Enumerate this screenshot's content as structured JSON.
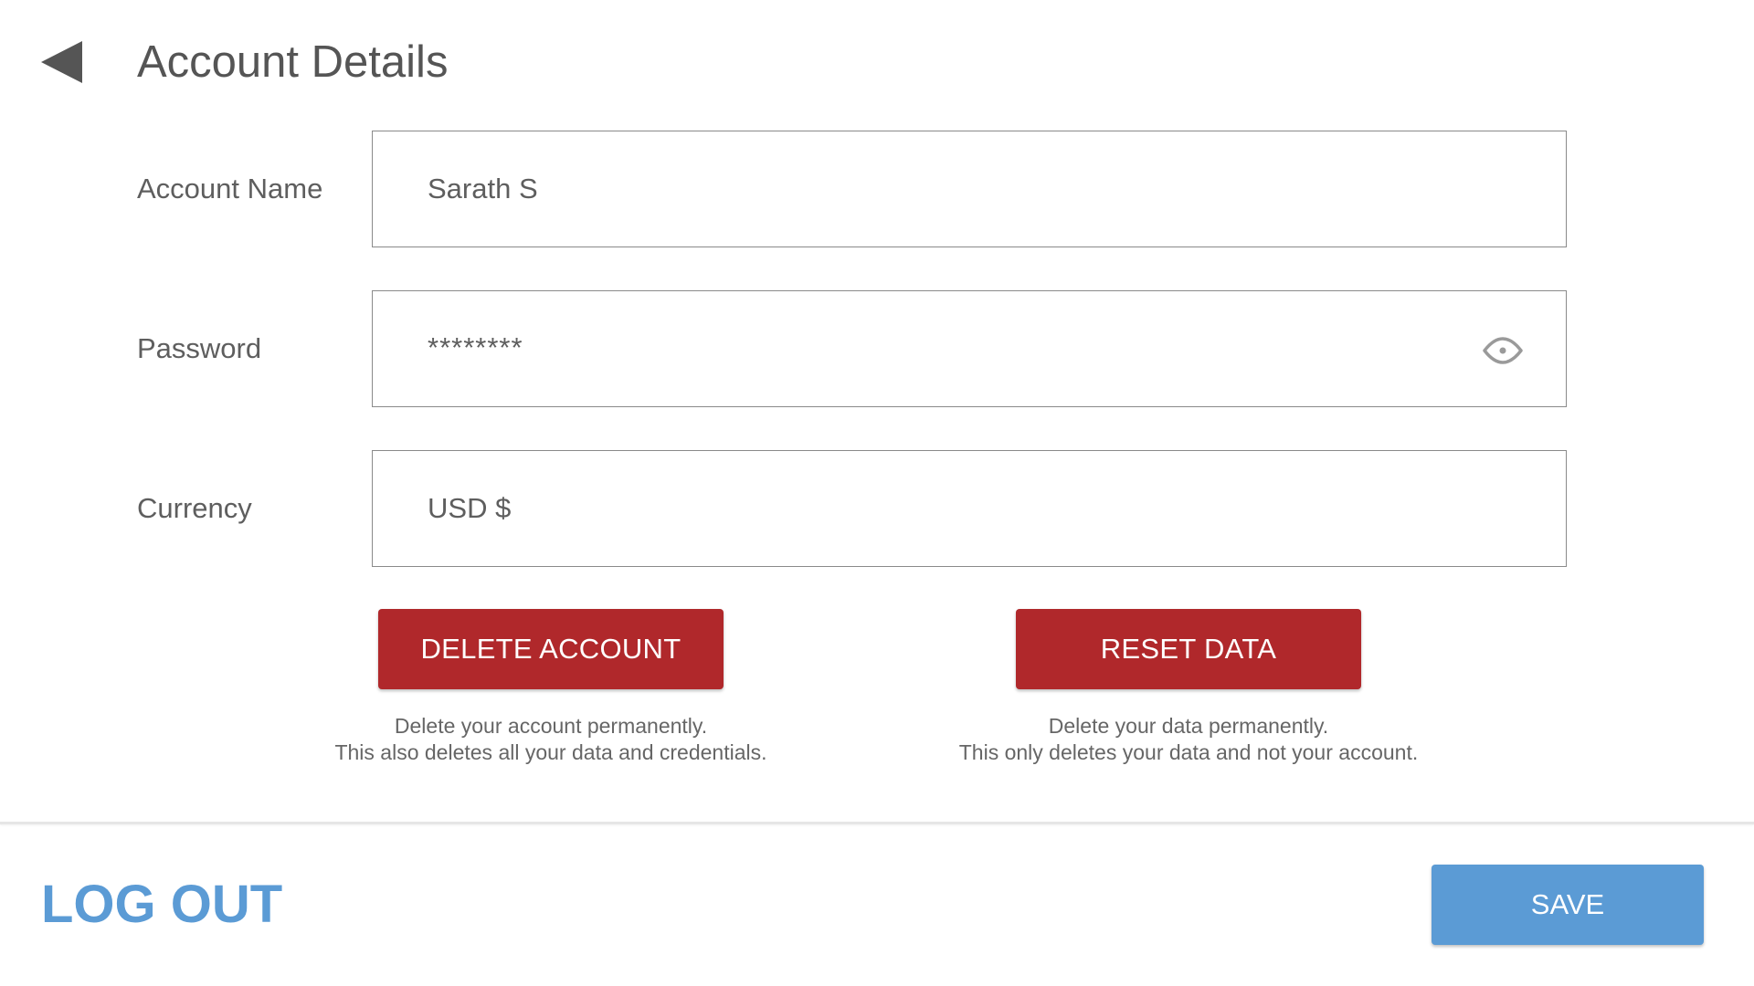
{
  "header": {
    "title": "Account Details"
  },
  "form": {
    "account_name": {
      "label": "Account Name",
      "value": "Sarath S"
    },
    "password": {
      "label": "Password",
      "value": "********"
    },
    "currency": {
      "label": "Currency",
      "value": "USD $"
    }
  },
  "actions": {
    "delete_account": {
      "label": "DELETE ACCOUNT",
      "help_line1": "Delete your account permanently.",
      "help_line2": "This also deletes all your data and credentials."
    },
    "reset_data": {
      "label": "RESET DATA",
      "help_line1": "Delete your data permanently.",
      "help_line2": "This only deletes your data and not your account."
    }
  },
  "footer": {
    "logout_label": "LOG OUT",
    "save_label": "SAVE"
  },
  "icons": {
    "back": "back-triangle-icon",
    "password_visibility": "eye-icon"
  },
  "colors": {
    "danger": "#b0282b",
    "primary": "#5b9bd5",
    "text": "#555555"
  }
}
